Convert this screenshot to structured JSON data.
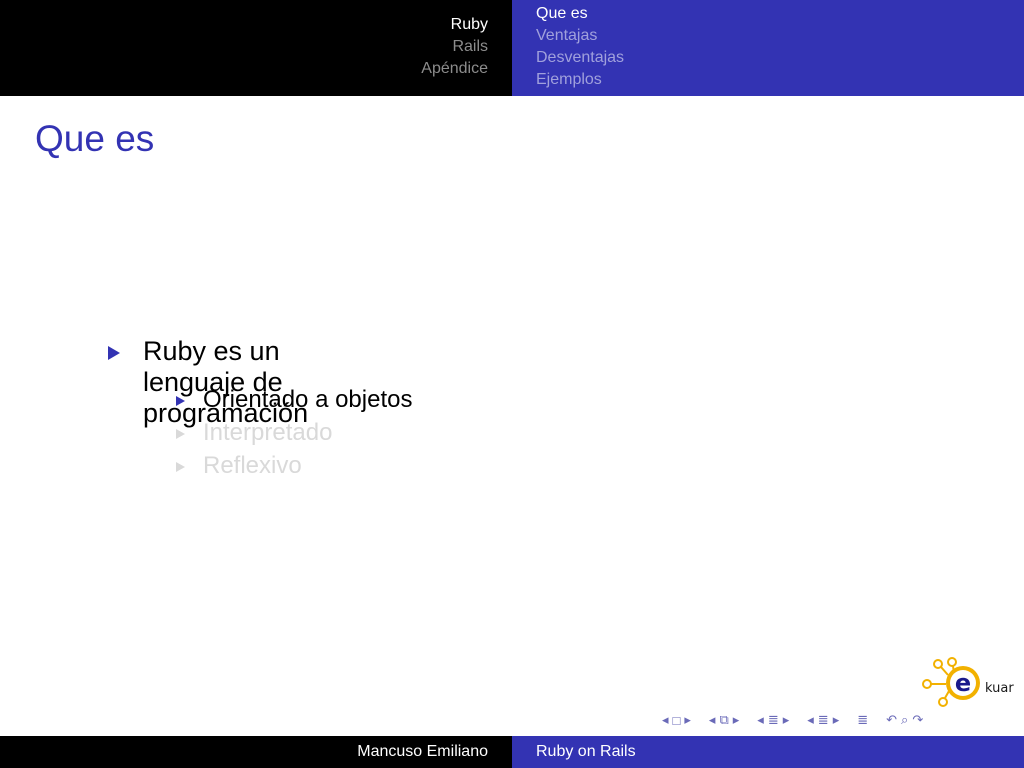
{
  "header": {
    "sections": [
      "Ruby",
      "Rails",
      "Apéndice"
    ],
    "subsections": [
      "Que es",
      "Ventajas",
      "Desventajas",
      "Ejemplos"
    ]
  },
  "frame": {
    "title": "Que es",
    "items": [
      {
        "text": "Ruby es un lenguaje de programación",
        "subitems": [
          {
            "text": "Orientado a objetos",
            "dimmed": false
          },
          {
            "text": "Interpretado",
            "dimmed": true
          },
          {
            "text": "Reflexivo",
            "dimmed": true
          }
        ]
      }
    ]
  },
  "logo": {
    "text": "kuar",
    "letter": "e"
  },
  "nav_icons": [
    "nav-prev-frame-icon",
    "nav-frame-icon",
    "nav-next-frame-icon",
    "nav-prev-slide-icon",
    "nav-slide-icon",
    "nav-next-slide-icon",
    "nav-prev-subsection-icon",
    "nav-subsection-icon",
    "nav-next-subsection-icon",
    "nav-prev-section-icon",
    "nav-section-icon",
    "nav-next-section-icon",
    "nav-document-icon",
    "nav-search-icon",
    "nav-undo-icon",
    "nav-redo-icon"
  ],
  "footer": {
    "author": "Mancuso Emiliano",
    "talk_title": "Ruby on Rails"
  },
  "colors": {
    "accent": "#3333b3",
    "header_dark": "#000000",
    "dim_text": "#d9d9d9"
  }
}
